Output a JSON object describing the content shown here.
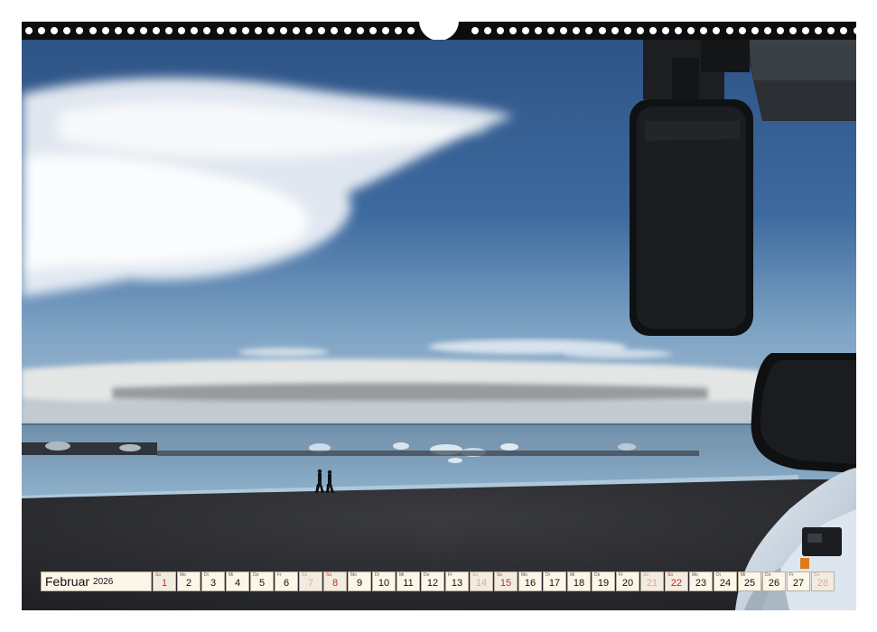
{
  "calendar": {
    "month": "Februar",
    "year": "2026",
    "days": [
      {
        "wd": "So",
        "day": "1",
        "kind": "sunday"
      },
      {
        "wd": "Mo",
        "day": "2",
        "kind": "weekday"
      },
      {
        "wd": "Di",
        "day": "3",
        "kind": "weekday"
      },
      {
        "wd": "Mi",
        "day": "4",
        "kind": "weekday"
      },
      {
        "wd": "Do",
        "day": "5",
        "kind": "weekday"
      },
      {
        "wd": "Fr",
        "day": "6",
        "kind": "weekday"
      },
      {
        "wd": "Sa",
        "day": "7",
        "kind": "weekend"
      },
      {
        "wd": "So",
        "day": "8",
        "kind": "sunday"
      },
      {
        "wd": "Mo",
        "day": "9",
        "kind": "weekday"
      },
      {
        "wd": "Di",
        "day": "10",
        "kind": "weekday"
      },
      {
        "wd": "Mi",
        "day": "11",
        "kind": "weekday"
      },
      {
        "wd": "Do",
        "day": "12",
        "kind": "weekday"
      },
      {
        "wd": "Fr",
        "day": "13",
        "kind": "weekday"
      },
      {
        "wd": "Sa",
        "day": "14",
        "kind": "weekend"
      },
      {
        "wd": "So",
        "day": "15",
        "kind": "sunday"
      },
      {
        "wd": "Mo",
        "day": "16",
        "kind": "weekday"
      },
      {
        "wd": "Di",
        "day": "17",
        "kind": "weekday"
      },
      {
        "wd": "Mi",
        "day": "18",
        "kind": "weekday"
      },
      {
        "wd": "Do",
        "day": "19",
        "kind": "weekday"
      },
      {
        "wd": "Fr",
        "day": "20",
        "kind": "weekday"
      },
      {
        "wd": "Sa",
        "day": "21",
        "kind": "weekend"
      },
      {
        "wd": "So",
        "day": "22",
        "kind": "sunday"
      },
      {
        "wd": "Mo",
        "day": "23",
        "kind": "weekday"
      },
      {
        "wd": "Di",
        "day": "24",
        "kind": "weekday"
      },
      {
        "wd": "Mi",
        "day": "25",
        "kind": "weekday"
      },
      {
        "wd": "Do",
        "day": "26",
        "kind": "weekday"
      },
      {
        "wd": "Fr",
        "day": "27",
        "kind": "weekday"
      },
      {
        "wd": "Sa",
        "day": "28",
        "kind": "weekend"
      }
    ]
  },
  "colors": {
    "sky_top": "#2f5486",
    "sky_bottom": "#8fb0cc",
    "sea": "#5d86a8",
    "beach": "#2a2b2f",
    "binding": "#0d0d0d",
    "sunday_red": "#c42d1f"
  }
}
